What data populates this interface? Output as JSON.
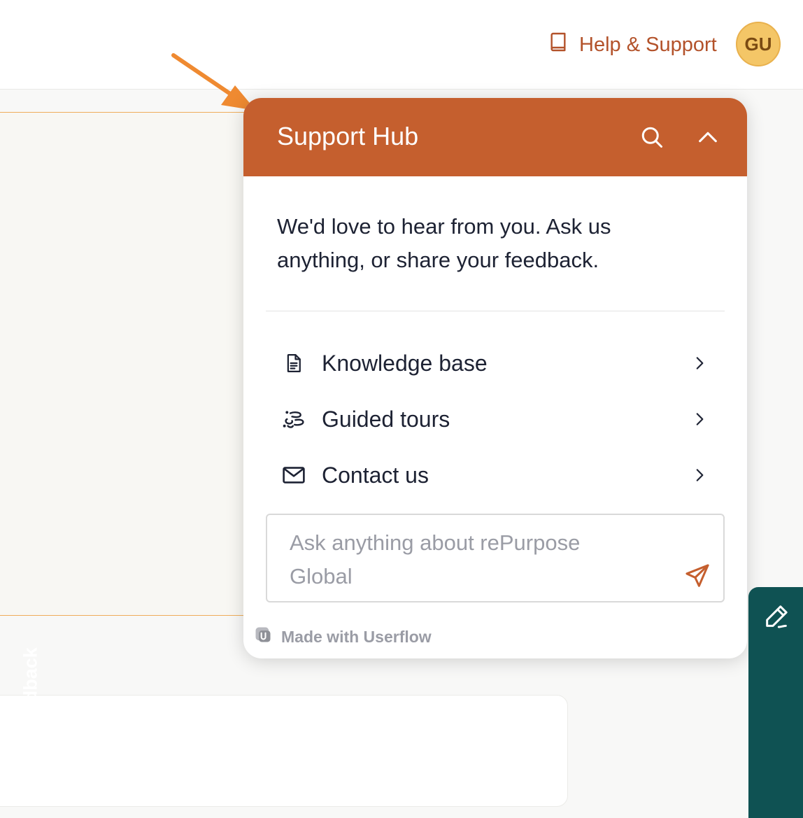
{
  "header": {
    "help_label": "Help & Support",
    "help_icon": "book-icon",
    "avatar_initials": "GU"
  },
  "panel": {
    "title": "Support Hub",
    "search_icon": "search-icon",
    "collapse_icon": "chevron-up-icon",
    "intro": "We'd love to hear from you. Ask us anything, or share your feedback.",
    "items": [
      {
        "label": "Knowledge base",
        "icon": "document-icon"
      },
      {
        "label": "Guided tours",
        "icon": "footsteps-icon"
      },
      {
        "label": "Contact us",
        "icon": "envelope-icon"
      }
    ],
    "ask_placeholder": "Ask anything about rePurpose Global",
    "made_with": "Made with Userflow"
  },
  "feedback_tab": {
    "label": "Share feedback",
    "icon": "pencil-icon"
  },
  "colors": {
    "accent": "#c55f2e",
    "help_text": "#b3522a",
    "avatar_bg": "#f4c667",
    "annotation_arrow": "#ef8a31",
    "feedback_tab": "#0f5253"
  }
}
